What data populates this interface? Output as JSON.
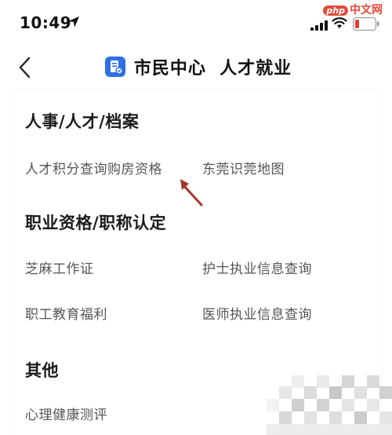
{
  "status_bar": {
    "time": "10:49",
    "watermark_php": "php",
    "watermark_text": "中文网"
  },
  "nav": {
    "title": "市民中心  人才就业"
  },
  "sections": [
    {
      "title": "人事/人才/档案",
      "items": [
        "人才积分查询购房资格",
        "东莞识莞地图"
      ]
    },
    {
      "title": "职业资格/职称认定",
      "items": [
        "芝麻工作证",
        "护士执业信息查询",
        "职工教育福利",
        "医师执业信息查询"
      ]
    },
    {
      "title": "其他",
      "items": [
        "心理健康测评"
      ]
    }
  ],
  "colors": {
    "accent_blue": "#2f6fe4",
    "arrow_red": "#a5352b",
    "battery_red": "#e53935"
  }
}
